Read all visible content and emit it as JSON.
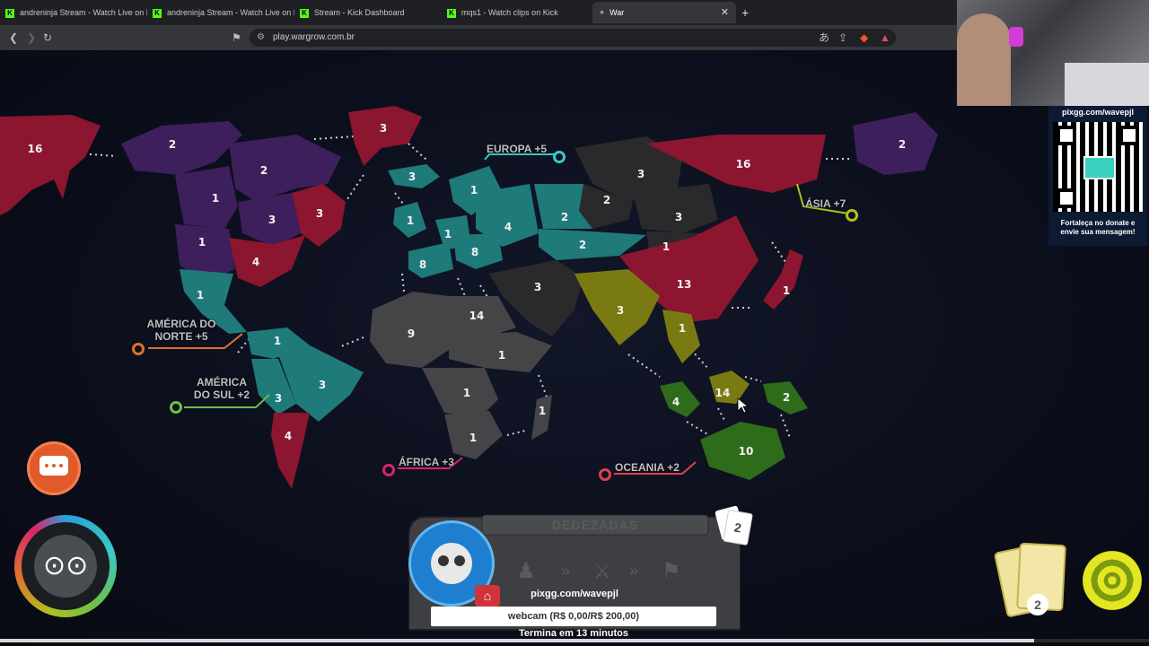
{
  "browser": {
    "tabs": [
      {
        "label": "andreninja Stream - Watch Live on K",
        "icon": "kick-icon"
      },
      {
        "label": "andreninja Stream - Watch Live on K",
        "icon": "kick-icon"
      },
      {
        "label": "Stream - Kick Dashboard",
        "icon": "kick-icon"
      },
      {
        "label": "mqs1 - Watch clips on Kick",
        "icon": "kick-icon"
      },
      {
        "label": "War",
        "icon": "war-icon",
        "active": true
      }
    ],
    "url": "play.wargrow.com.br"
  },
  "continents": {
    "north_america": {
      "name_line1": "AMÉRICA DO",
      "name_line2": "NORTE +5"
    },
    "south_america": {
      "name_line1": "AMÉRICA",
      "name_line2": "DO SUL +2"
    },
    "europe": {
      "name": "EUROPA +5"
    },
    "africa": {
      "name": "ÁFRICA +3"
    },
    "asia": {
      "name": "ÁSIA +7"
    },
    "oceania": {
      "name": "OCEANIA +2"
    }
  },
  "territories": [
    {
      "id": "alaska",
      "armies": "16",
      "color": "#8c1530"
    },
    {
      "id": "mackenzie",
      "armies": "2",
      "color": "#3d1f5c"
    },
    {
      "id": "greenland",
      "armies": "3",
      "color": "#8c1530"
    },
    {
      "id": "vancouver",
      "armies": "1",
      "color": "#3d1f5c"
    },
    {
      "id": "ottawa",
      "armies": "2",
      "color": "#3d1f5c"
    },
    {
      "id": "labrador",
      "armies": "3",
      "color": "#8c1530"
    },
    {
      "id": "ny_center",
      "armies": "3",
      "color": "#3d1f5c"
    },
    {
      "id": "california",
      "armies": "1",
      "color": "#3d1f5c"
    },
    {
      "id": "new_york",
      "armies": "4",
      "color": "#8c1530"
    },
    {
      "id": "mexico",
      "armies": "1",
      "color": "#1f7a7a"
    },
    {
      "id": "iceland",
      "armies": "3",
      "color": "#1f7a7a"
    },
    {
      "id": "england",
      "armies": "1",
      "color": "#1f7a7a"
    },
    {
      "id": "sweden",
      "armies": "1",
      "color": "#1f7a7a"
    },
    {
      "id": "germany",
      "armies": "1",
      "color": "#1f7a7a"
    },
    {
      "id": "moscow",
      "armies": "4",
      "color": "#1f7a7a"
    },
    {
      "id": "poland",
      "armies": "8",
      "color": "#1f7a7a"
    },
    {
      "id": "portugal",
      "armies": "8",
      "color": "#1f7a7a"
    },
    {
      "id": "omsk",
      "armies": "2",
      "color": "#1f7a7a"
    },
    {
      "id": "aral",
      "armies": "2",
      "color": "#1f7a7a"
    },
    {
      "id": "dudinka",
      "armies": "3",
      "color": "#2a2a2d"
    },
    {
      "id": "siberia",
      "armies": "16",
      "color": "#8c1530"
    },
    {
      "id": "vladivostok",
      "armies": "2",
      "color": "#3d1f5c"
    },
    {
      "id": "tchita",
      "armies": "2",
      "color": "#2a2a2d"
    },
    {
      "id": "mongolia",
      "armies": "3",
      "color": "#2a2a2d"
    },
    {
      "id": "china_n",
      "armies": "1",
      "color": "#2a2a2d"
    },
    {
      "id": "china",
      "armies": "13",
      "color": "#8c1530"
    },
    {
      "id": "japan",
      "armies": "1",
      "color": "#8c1530"
    },
    {
      "id": "middle_east",
      "armies": "3",
      "color": "#2a2a2d"
    },
    {
      "id": "india",
      "armies": "3",
      "color": "#7a7a12"
    },
    {
      "id": "vietnam",
      "armies": "1",
      "color": "#7a7a12"
    },
    {
      "id": "egypt",
      "armies": "14",
      "color": "#454548"
    },
    {
      "id": "algeria",
      "armies": "9",
      "color": "#454548"
    },
    {
      "id": "sudan",
      "armies": "1",
      "color": "#454548"
    },
    {
      "id": "congo",
      "armies": "1",
      "color": "#454548"
    },
    {
      "id": "madagascar",
      "armies": "1",
      "color": "#454548"
    },
    {
      "id": "south_africa",
      "armies": "1",
      "color": "#454548"
    },
    {
      "id": "venezuela",
      "armies": "1",
      "color": "#1f7a7a"
    },
    {
      "id": "brazil",
      "armies": "3",
      "color": "#1f7a7a"
    },
    {
      "id": "peru",
      "armies": "3",
      "color": "#1f7a7a"
    },
    {
      "id": "argentina",
      "armies": "4",
      "color": "#8c1530"
    },
    {
      "id": "sumatra",
      "armies": "4",
      "color": "#2e6b1a"
    },
    {
      "id": "borneo",
      "armies": "14",
      "color": "#7a7a12"
    },
    {
      "id": "new_guinea",
      "armies": "2",
      "color": "#2e6b1a"
    },
    {
      "id": "australia",
      "armies": "10",
      "color": "#2e6b1a"
    }
  ],
  "hud": {
    "phase_title": "DEDEZADAS",
    "card_count": "2",
    "pixgg_text": "pixgg.com/wavepjl",
    "donate_text": "webcam (R$ 0,00/R$ 200,00)",
    "footer_text": "Termina em 13 minutos",
    "hand_cards_count": "2"
  },
  "overlay": {
    "qr_url": "pixgg.com/wavepjl",
    "qr_caption": "Fortaleça no donate e envie sua mensagem!"
  },
  "progress": {
    "fraction": 0.9
  }
}
